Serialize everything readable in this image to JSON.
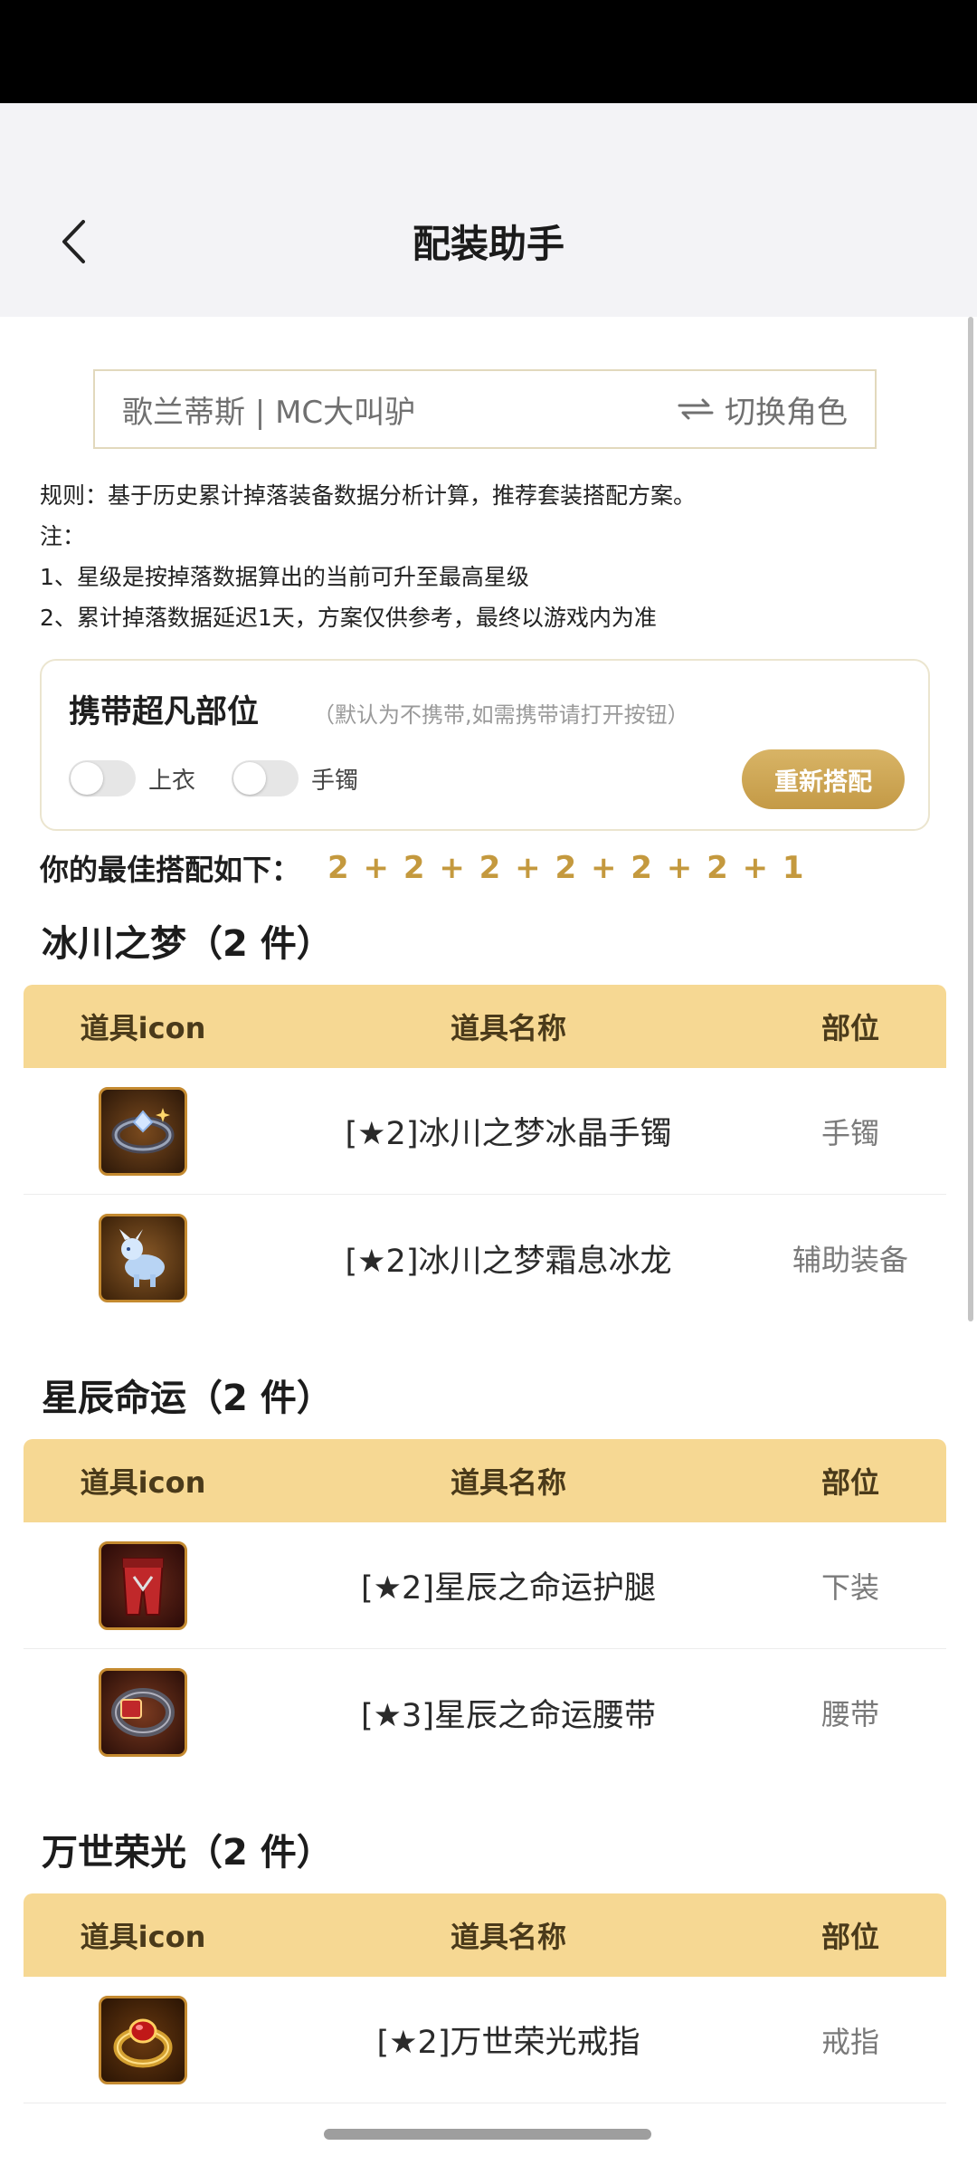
{
  "nav": {
    "title": "配装助手"
  },
  "role": {
    "name": "歌兰蒂斯 | MC大叫驴",
    "switch_label": "切换角色"
  },
  "rules": {
    "line1": "规则：基于历史累计掉落装备数据分析计算，推荐套装搭配方案。",
    "line2": "注：",
    "line3": "1、星级是按掉落数据算出的当前可升至最高星级",
    "line4": "2、累计掉落数据延迟1天，方案仅供参考，最终以游戏内为准"
  },
  "carry": {
    "title": "携带超凡部位",
    "hint": "（默认为不携带,如需携带请打开按钮）",
    "toggles": [
      {
        "label": "上衣",
        "on": false
      },
      {
        "label": "手镯",
        "on": false
      }
    ],
    "rematch_label": "重新搭配"
  },
  "best": {
    "label": "你的最佳搭配如下：",
    "value": "2 + 2 + 2 + 2 + 2 + 2 + 1"
  },
  "table_headers": {
    "icon": "道具icon",
    "name": "道具名称",
    "slot": "部位"
  },
  "sets": [
    {
      "title": "冰川之梦（2 件）",
      "items": [
        {
          "icon": "ice-bracelet-icon",
          "name": "[★2]冰川之梦冰晶手镯",
          "slot": "手镯"
        },
        {
          "icon": "frost-dragon-icon",
          "name": "[★2]冰川之梦霜息冰龙",
          "slot": "辅助装备"
        }
      ]
    },
    {
      "title": "星辰命运（2 件）",
      "items": [
        {
          "icon": "red-leggings-icon",
          "name": "[★2]星辰之命运护腿",
          "slot": "下装"
        },
        {
          "icon": "red-belt-icon",
          "name": "[★3]星辰之命运腰带",
          "slot": "腰带"
        }
      ]
    },
    {
      "title": "万世荣光（2 件）",
      "items": [
        {
          "icon": "gold-ring-icon",
          "name": "[★2]万世荣光戒指",
          "slot": "戒指"
        }
      ]
    }
  ],
  "colors": {
    "header_bg": "#f6d893",
    "accent_gold": "#c4993e",
    "button_gold": "#cfa656"
  }
}
